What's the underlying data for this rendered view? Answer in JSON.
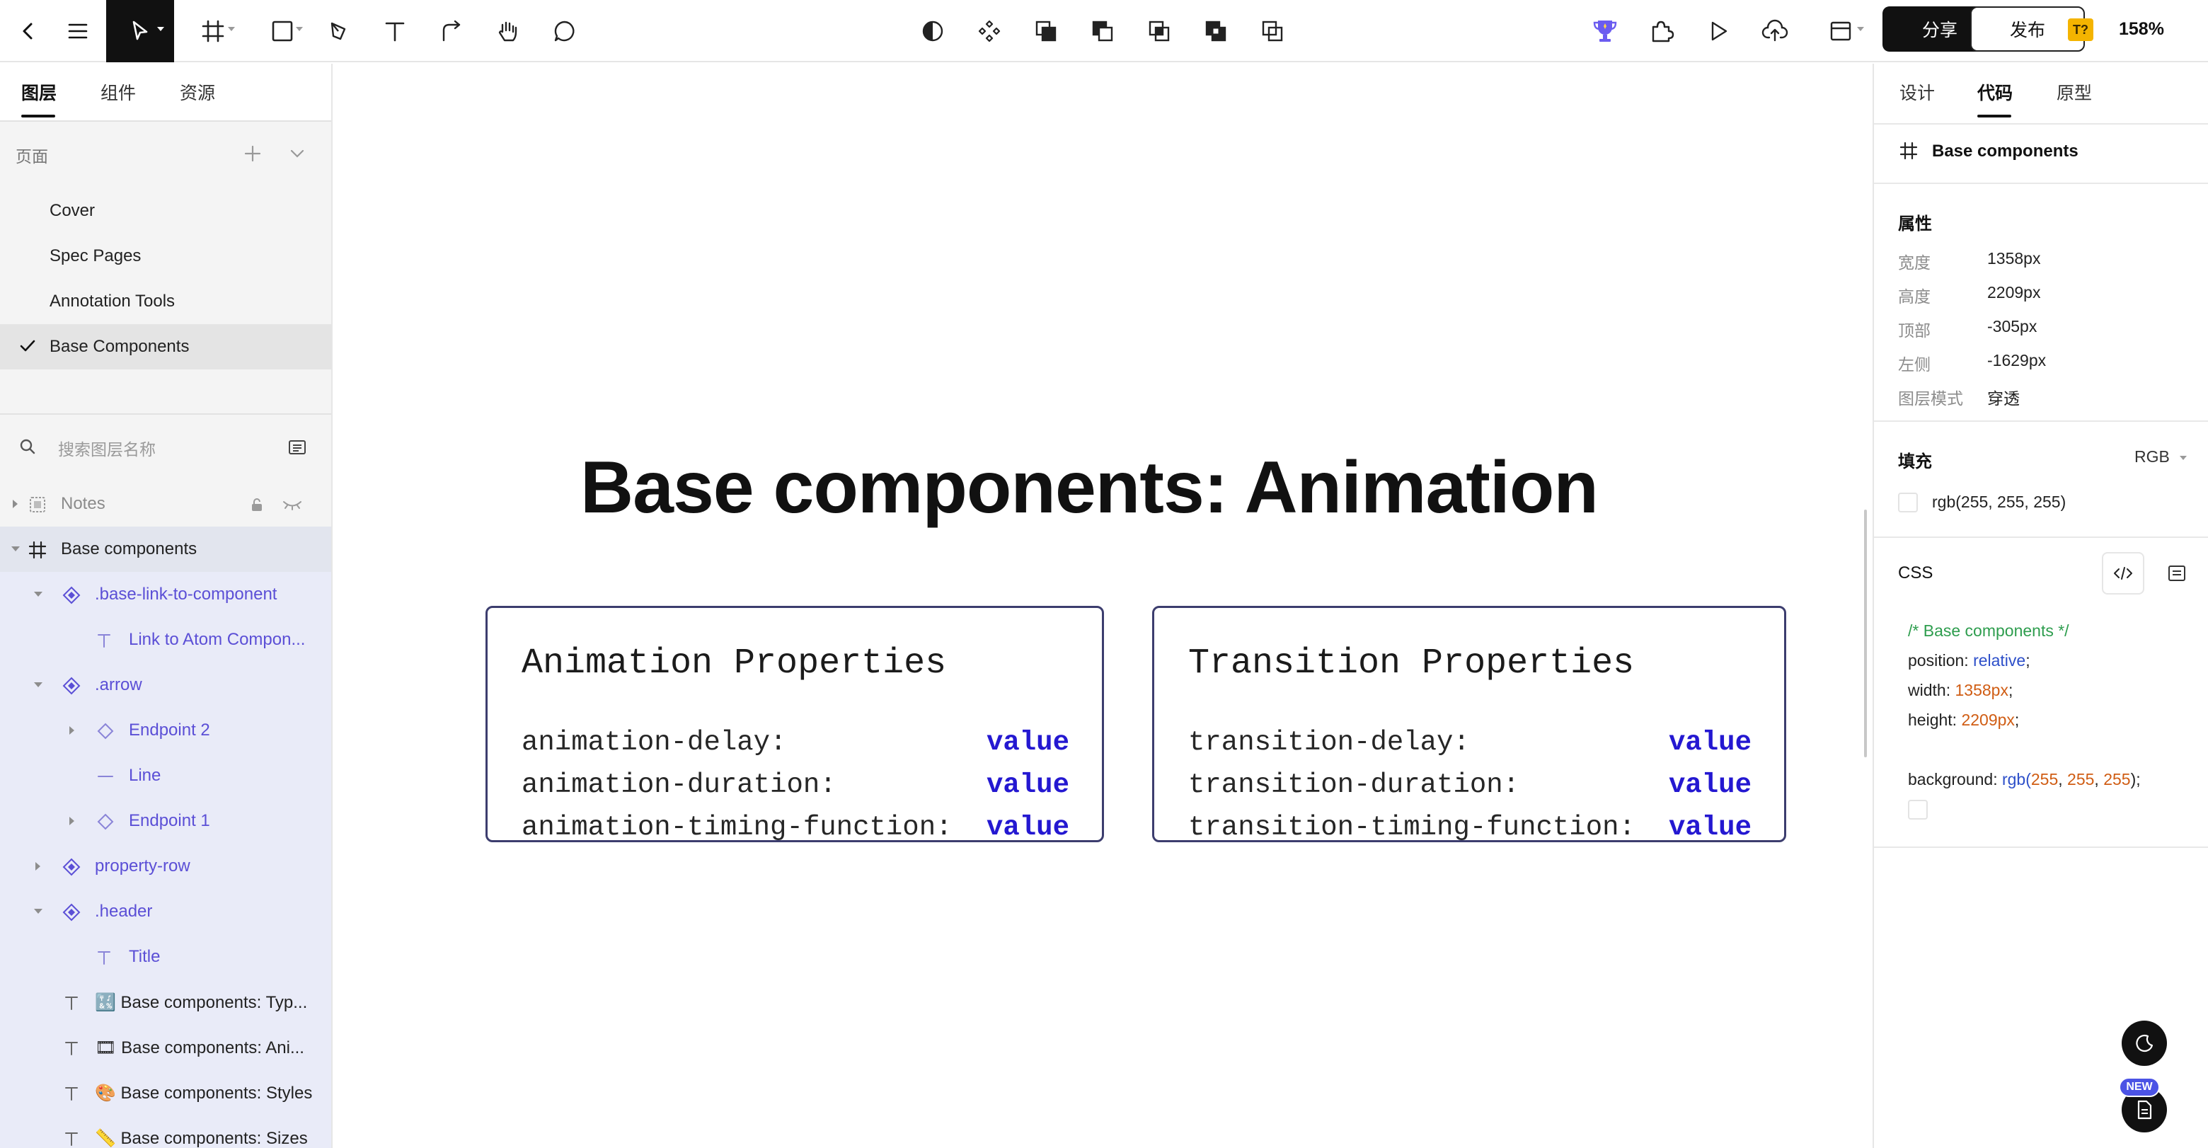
{
  "toolbar": {
    "back_icon": "chevron-left-icon",
    "tools": [
      "pointer-tool",
      "frame-tool",
      "rectangle-tool",
      "pen-tool",
      "text-tool",
      "connector-tool",
      "hand-tool",
      "comment-tool"
    ],
    "center_tools": [
      "mask",
      "component",
      "union",
      "subtract",
      "intersect",
      "exclude",
      "flatten"
    ],
    "share_label": "分享",
    "publish_label": "发布",
    "badge_label": "T?",
    "zoom": "158%"
  },
  "left_panel": {
    "tabs": [
      "图层",
      "组件",
      "资源"
    ],
    "pages_label": "页面",
    "pages": [
      "Cover",
      "Spec Pages",
      "Annotation Tools",
      "Base Components"
    ],
    "search_placeholder": "搜索图层名称",
    "layers": [
      {
        "label": "Notes"
      },
      {
        "label": "Base components"
      },
      {
        "label": ".base-link-to-component"
      },
      {
        "label": "Link to Atom Compon..."
      },
      {
        "label": ".arrow"
      },
      {
        "label": "Endpoint 2"
      },
      {
        "label": "Line"
      },
      {
        "label": "Endpoint 1"
      },
      {
        "label": "property-row"
      },
      {
        "label": ".header"
      },
      {
        "label": "Title"
      },
      {
        "label": "🔣 Base components: Typ..."
      },
      {
        "label": "🎞 Base components: Ani..."
      },
      {
        "label": "🎨 Base components: Styles"
      },
      {
        "label": "📏 Base components: Sizes"
      }
    ]
  },
  "canvas": {
    "title": "Base components: Animation",
    "cards": [
      {
        "title": "Animation Properties",
        "rows": [
          {
            "name": "animation-delay:",
            "value": "value"
          },
          {
            "name": "animation-duration:",
            "value": "value"
          },
          {
            "name": "animation-timing-function:",
            "value": "value"
          }
        ]
      },
      {
        "title": "Transition Properties",
        "rows": [
          {
            "name": "transition-delay:",
            "value": "value"
          },
          {
            "name": "transition-duration:",
            "value": "value"
          },
          {
            "name": "transition-timing-function:",
            "value": "value"
          }
        ]
      }
    ]
  },
  "right_panel": {
    "tabs": [
      "设计",
      "代码",
      "原型"
    ],
    "frame_name": "Base components",
    "properties_label": "属性",
    "properties": [
      {
        "label": "宽度",
        "value": "1358px"
      },
      {
        "label": "高度",
        "value": "2209px"
      },
      {
        "label": "顶部",
        "value": "-305px"
      },
      {
        "label": "左侧",
        "value": "-1629px"
      },
      {
        "label": "图层模式",
        "value": "穿透"
      }
    ],
    "fill_label": "填充",
    "fill_mode": "RGB",
    "fill_value": "rgb(255, 255, 255)",
    "css_label": "CSS",
    "css": {
      "comment": "/* Base components */",
      "position_prop": "position: ",
      "position_val": "relative",
      "width_prop": "width: ",
      "width_val": "1358px",
      "height_prop": "height: ",
      "height_val": "2209px",
      "bg_prop": "background: ",
      "bg_fn": "rgb(",
      "bg_r": "255",
      "bg_g": "255",
      "bg_b": "255",
      "bg_end": ");",
      "sep": ", ",
      "semi": ";"
    },
    "new_badge": "NEW"
  },
  "colors": {
    "accent_purple": "#5b4fd6",
    "value_blue": "#2418d1",
    "card_border": "#3c3d6e",
    "toolbar_active": "#111111"
  }
}
